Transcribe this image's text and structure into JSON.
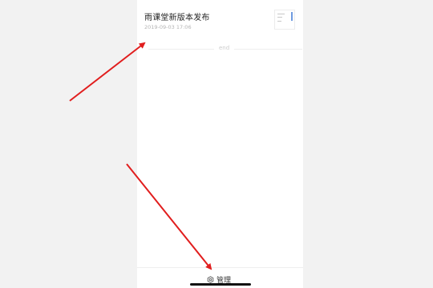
{
  "article": {
    "title": "雨课堂新版本发布",
    "time": "2019-09-03 17:06",
    "thumbnail_icon": "document-preview-thumbnail"
  },
  "list": {
    "end_label": "end"
  },
  "bottom_bar": {
    "manage_label": "管理",
    "manage_icon": "gear-icon"
  },
  "annotations": {
    "arrow_color": "#e11e1e"
  }
}
